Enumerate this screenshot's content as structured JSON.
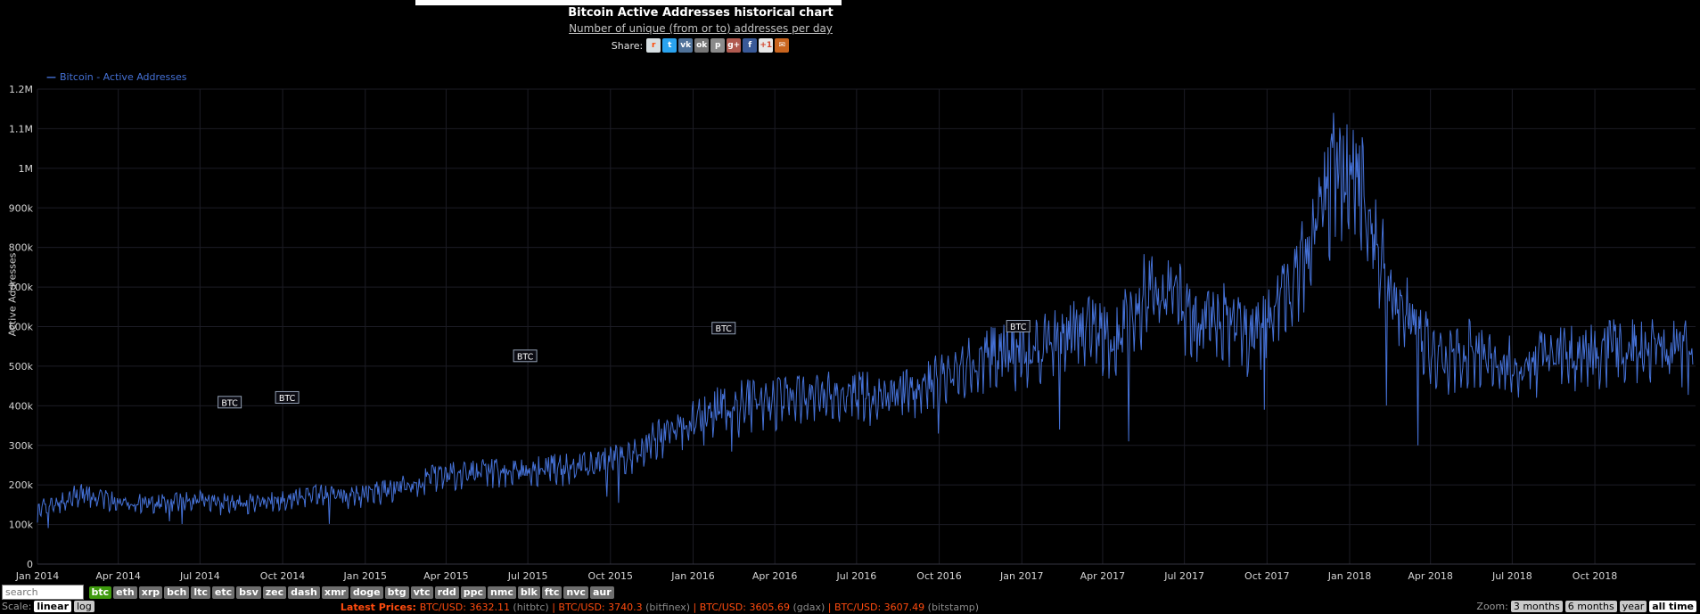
{
  "header": {
    "title": "Bitcoin Active Addresses historical chart",
    "subtitle": "Number of unique (from or to) addresses per day",
    "share_label": "Share:",
    "share_icons": [
      {
        "name": "reddit",
        "glyph": "r",
        "color": "#d7dfe2",
        "text": "#ff4500"
      },
      {
        "name": "twitter",
        "glyph": "t",
        "color": "#2aa3ef",
        "text": "#ffffff"
      },
      {
        "name": "vk",
        "glyph": "vk",
        "color": "#507299",
        "text": "#ffffff"
      },
      {
        "name": "odnoklassniki",
        "glyph": "ok",
        "color": "#777777",
        "text": "#ffffff"
      },
      {
        "name": "pinterest",
        "glyph": "p",
        "color": "#8a8a8a",
        "text": "#ffffff"
      },
      {
        "name": "google-plus",
        "glyph": "g+",
        "color": "#b05a50",
        "text": "#ffffff"
      },
      {
        "name": "facebook",
        "glyph": "f",
        "color": "#3a5a98",
        "text": "#ffffff"
      },
      {
        "name": "google-plus-one",
        "glyph": "+1",
        "color": "#e8e8e8",
        "text": "#d4472e"
      },
      {
        "name": "email",
        "glyph": "✉",
        "color": "#c9651f",
        "text": "#ffffff"
      }
    ]
  },
  "legend": {
    "label": "Bitcoin - Active Addresses"
  },
  "chart_data": {
    "type": "line",
    "title": "Bitcoin Active Addresses historical chart",
    "subtitle": "Number of unique (from or to) addresses per day",
    "xlabel": "",
    "ylabel": "Active Addresses",
    "ylim": [
      0,
      1200000
    ],
    "grid": true,
    "background": "#000000",
    "legend_position": "top-left",
    "y_ticks": [
      {
        "value": 0,
        "label": "0"
      },
      {
        "value": 100000,
        "label": "100k"
      },
      {
        "value": 200000,
        "label": "200k"
      },
      {
        "value": 300000,
        "label": "300k"
      },
      {
        "value": 400000,
        "label": "400k"
      },
      {
        "value": 500000,
        "label": "500k"
      },
      {
        "value": 600000,
        "label": "600k"
      },
      {
        "value": 700000,
        "label": "700k"
      },
      {
        "value": 800000,
        "label": "800k"
      },
      {
        "value": 900000,
        "label": "900k"
      },
      {
        "value": 1000000,
        "label": "1M"
      },
      {
        "value": 1100000,
        "label": "1.1M"
      },
      {
        "value": 1200000,
        "label": "1.2M"
      }
    ],
    "x_ticks": [
      {
        "date": "2014-01-01",
        "label": "Jan 2014"
      },
      {
        "date": "2014-04-01",
        "label": "Apr 2014"
      },
      {
        "date": "2014-07-01",
        "label": "Jul 2014"
      },
      {
        "date": "2014-10-01",
        "label": "Oct 2014"
      },
      {
        "date": "2015-01-01",
        "label": "Jan 2015"
      },
      {
        "date": "2015-04-01",
        "label": "Apr 2015"
      },
      {
        "date": "2015-07-01",
        "label": "Jul 2015"
      },
      {
        "date": "2015-10-01",
        "label": "Oct 2015"
      },
      {
        "date": "2016-01-01",
        "label": "Jan 2016"
      },
      {
        "date": "2016-04-01",
        "label": "Apr 2016"
      },
      {
        "date": "2016-07-01",
        "label": "Jul 2016"
      },
      {
        "date": "2016-10-01",
        "label": "Oct 2016"
      },
      {
        "date": "2017-01-01",
        "label": "Jan 2017"
      },
      {
        "date": "2017-04-01",
        "label": "Apr 2017"
      },
      {
        "date": "2017-07-01",
        "label": "Jul 2017"
      },
      {
        "date": "2017-10-01",
        "label": "Oct 2017"
      },
      {
        "date": "2018-01-01",
        "label": "Jan 2018"
      },
      {
        "date": "2018-04-01",
        "label": "Apr 2018"
      },
      {
        "date": "2018-07-01",
        "label": "Jul 2018"
      },
      {
        "date": "2018-10-01",
        "label": "Oct 2018"
      }
    ],
    "series": [
      {
        "name": "Bitcoin - Active Addresses",
        "color": "#4571d6",
        "unit": "addresses/day",
        "monthly_anchors": [
          {
            "m": "2014-01",
            "v": 150000
          },
          {
            "m": "2014-02",
            "v": 185000
          },
          {
            "m": "2014-03",
            "v": 172000
          },
          {
            "m": "2014-04",
            "v": 165000
          },
          {
            "m": "2014-05",
            "v": 160000
          },
          {
            "m": "2014-06",
            "v": 170000
          },
          {
            "m": "2014-07",
            "v": 165000
          },
          {
            "m": "2014-08",
            "v": 158000
          },
          {
            "m": "2014-09",
            "v": 166000
          },
          {
            "m": "2014-10",
            "v": 172000
          },
          {
            "m": "2014-11",
            "v": 183000
          },
          {
            "m": "2014-12",
            "v": 176000
          },
          {
            "m": "2015-01",
            "v": 188000
          },
          {
            "m": "2015-02",
            "v": 205000
          },
          {
            "m": "2015-03",
            "v": 225000
          },
          {
            "m": "2015-04",
            "v": 235000
          },
          {
            "m": "2015-05",
            "v": 240000
          },
          {
            "m": "2015-06",
            "v": 246000
          },
          {
            "m": "2015-07",
            "v": 250000
          },
          {
            "m": "2015-08",
            "v": 252000
          },
          {
            "m": "2015-09",
            "v": 258000
          },
          {
            "m": "2015-10",
            "v": 280000
          },
          {
            "m": "2015-11",
            "v": 320000
          },
          {
            "m": "2015-12",
            "v": 355000
          },
          {
            "m": "2016-01",
            "v": 395000
          },
          {
            "m": "2016-02",
            "v": 418000
          },
          {
            "m": "2016-03",
            "v": 425000
          },
          {
            "m": "2016-04",
            "v": 432000
          },
          {
            "m": "2016-05",
            "v": 436000
          },
          {
            "m": "2016-06",
            "v": 450000
          },
          {
            "m": "2016-07",
            "v": 437000
          },
          {
            "m": "2016-08",
            "v": 446000
          },
          {
            "m": "2016-09",
            "v": 465000
          },
          {
            "m": "2016-10",
            "v": 495000
          },
          {
            "m": "2016-11",
            "v": 530000
          },
          {
            "m": "2016-12",
            "v": 555000
          },
          {
            "m": "2017-01",
            "v": 565000
          },
          {
            "m": "2017-02",
            "v": 585000
          },
          {
            "m": "2017-03",
            "v": 615000
          },
          {
            "m": "2017-04",
            "v": 585000
          },
          {
            "m": "2017-05",
            "v": 705000
          },
          {
            "m": "2017-06",
            "v": 725000
          },
          {
            "m": "2017-07",
            "v": 615000
          },
          {
            "m": "2017-08",
            "v": 645000
          },
          {
            "m": "2017-09",
            "v": 590000
          },
          {
            "m": "2017-10",
            "v": 680000
          },
          {
            "m": "2017-11",
            "v": 830000
          },
          {
            "m": "2017-12",
            "v": 1020000
          },
          {
            "m": "2018-01",
            "v": 980000
          },
          {
            "m": "2018-02",
            "v": 720000
          },
          {
            "m": "2018-03",
            "v": 620000
          },
          {
            "m": "2018-04",
            "v": 530000
          },
          {
            "m": "2018-05",
            "v": 560000
          },
          {
            "m": "2018-06",
            "v": 530000
          },
          {
            "m": "2018-07",
            "v": 520000
          },
          {
            "m": "2018-08",
            "v": 540000
          },
          {
            "m": "2018-09",
            "v": 545000
          },
          {
            "m": "2018-10",
            "v": 555000
          },
          {
            "m": "2018-11",
            "v": 565000
          },
          {
            "m": "2018-12",
            "v": 560000
          },
          {
            "m": "2019-01",
            "v": 555000
          }
        ],
        "spikes": [
          {
            "date": "2014-01-01",
            "value": 105000
          },
          {
            "date": "2015-10-10",
            "value": 155000
          },
          {
            "date": "2016-02-21",
            "value": 320000
          },
          {
            "date": "2017-02-12",
            "value": 340000
          },
          {
            "date": "2017-04-30",
            "value": 310000
          },
          {
            "date": "2017-12-14",
            "value": 1140000
          },
          {
            "date": "2018-03-18",
            "value": 300000
          }
        ]
      }
    ],
    "annotations": [
      {
        "label": "BTC",
        "date": "2014-08-03",
        "value": 408000
      },
      {
        "label": "BTC",
        "date": "2014-10-06",
        "value": 420000
      },
      {
        "label": "BTC",
        "date": "2015-06-28",
        "value": 525000
      },
      {
        "label": "BTC",
        "date": "2016-02-04",
        "value": 595000
      },
      {
        "label": "BTC",
        "date": "2016-12-28",
        "value": 600000
      }
    ]
  },
  "controls": {
    "search_placeholder": "search",
    "coins": [
      {
        "label": "btc",
        "active": true
      },
      {
        "label": "eth"
      },
      {
        "label": "xrp"
      },
      {
        "label": "bch"
      },
      {
        "label": "ltc"
      },
      {
        "label": "etc"
      },
      {
        "label": "bsv"
      },
      {
        "label": "zec"
      },
      {
        "label": "dash"
      },
      {
        "label": "xmr"
      },
      {
        "label": "doge"
      },
      {
        "label": "btg"
      },
      {
        "label": "vtc"
      },
      {
        "label": "rdd"
      },
      {
        "label": "ppc"
      },
      {
        "label": "nmc"
      },
      {
        "label": "blk"
      },
      {
        "label": "ftc"
      },
      {
        "label": "nvc"
      },
      {
        "label": "aur"
      }
    ],
    "scale_label": "Scale:",
    "scale_options": [
      {
        "label": "linear",
        "active": true
      },
      {
        "label": "log",
        "active": false
      }
    ],
    "zoom_label": "Zoom:",
    "zoom_options": [
      {
        "label": "3 months",
        "active": false
      },
      {
        "label": "6 months",
        "active": false
      },
      {
        "label": "year",
        "active": false
      },
      {
        "label": "all time",
        "active": true
      }
    ]
  },
  "prices": {
    "label": "Latest Prices:",
    "items": [
      {
        "pair": "BTC/USD",
        "price": "3632.11",
        "exchange": "hitbtc"
      },
      {
        "pair": "BTC/USD",
        "price": "3740.3",
        "exchange": "bitfinex"
      },
      {
        "pair": "BTC/USD",
        "price": "3605.69",
        "exchange": "gdax"
      },
      {
        "pair": "BTC/USD",
        "price": "3607.49",
        "exchange": "bitstamp"
      }
    ]
  },
  "colors": {
    "background": "#000000",
    "line": "#4571d6",
    "price_text": "#ff4b0e",
    "active_coin": "#3f9a0e"
  }
}
